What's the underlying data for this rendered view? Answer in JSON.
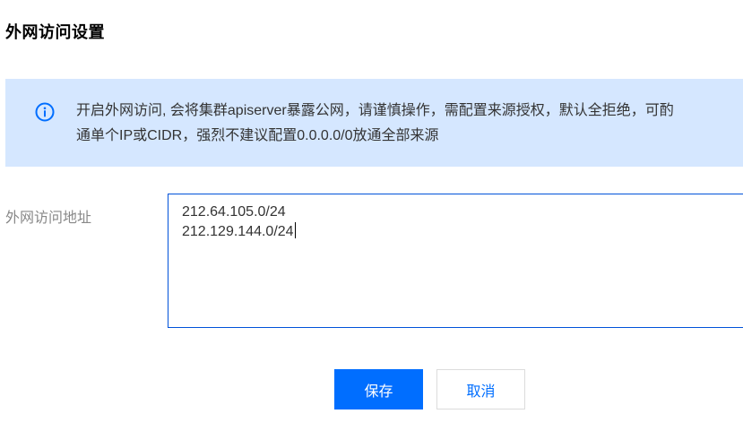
{
  "page": {
    "title": "外网访问设置"
  },
  "notice": {
    "icon": "info-circle-icon",
    "line1": "开启外网访问, 会将集群apiserver暴露公网，请谨慎操作，需配置来源授权，默认全拒绝，可酌",
    "line2": "通单个IP或CIDR，强烈不建议配置0.0.0.0/0放通全部来源"
  },
  "form": {
    "address_label": "外网访问地址",
    "address_lines": [
      "212.64.105.0/24",
      "212.129.144.0/24"
    ]
  },
  "actions": {
    "save_label": "保存",
    "cancel_label": "取消"
  },
  "colors": {
    "primary": "#006eff",
    "notice_bg": "#d5e7ff",
    "focus_border": "#0052d9"
  }
}
